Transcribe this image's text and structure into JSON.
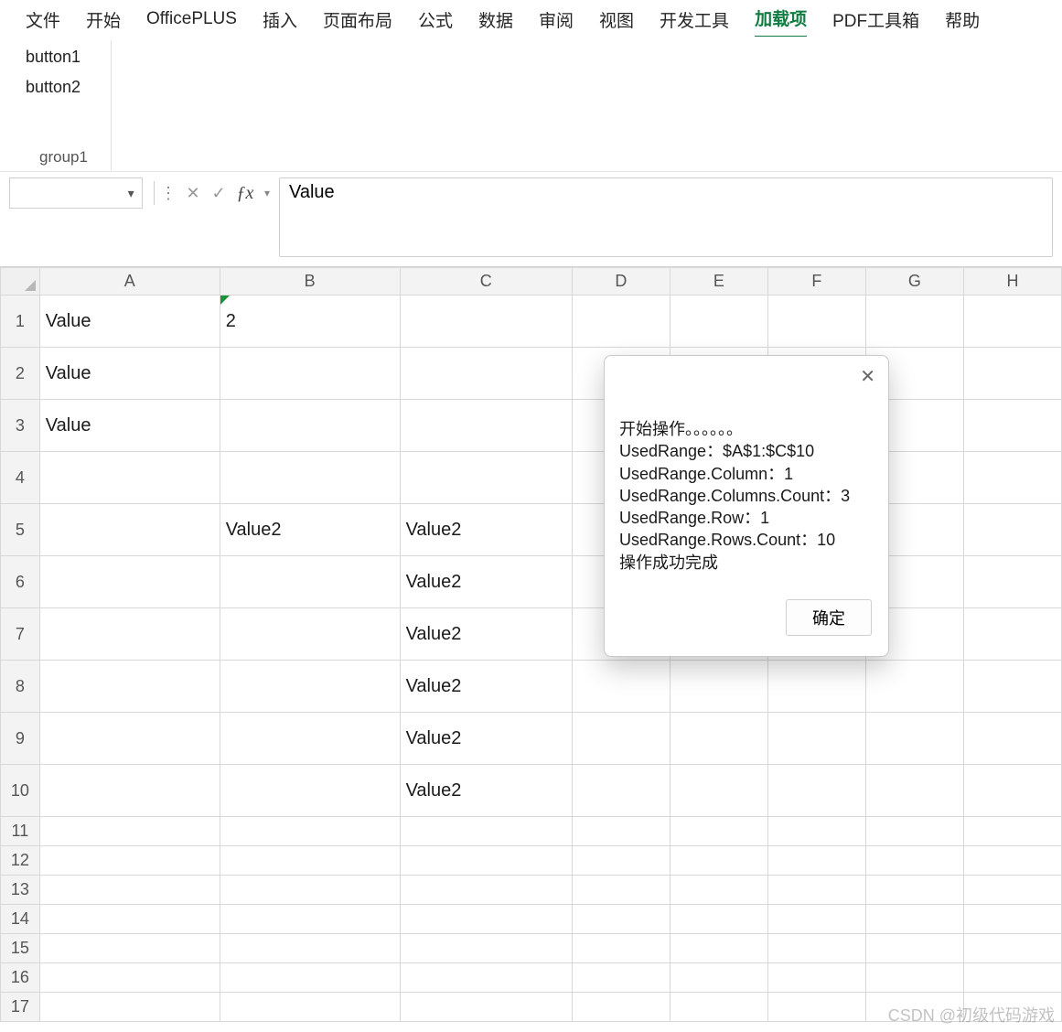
{
  "ribbon": {
    "tabs": [
      "文件",
      "开始",
      "OfficePLUS",
      "插入",
      "页面布局",
      "公式",
      "数据",
      "审阅",
      "视图",
      "开发工具",
      "加载项",
      "PDF工具箱",
      "帮助"
    ],
    "active_index": 10
  },
  "addin": {
    "buttons": [
      "button1",
      "button2"
    ],
    "group_label": "group1"
  },
  "namebox": {
    "value": ""
  },
  "formula_bar": {
    "value": "Value"
  },
  "grid": {
    "columns": [
      "A",
      "B",
      "C",
      "D",
      "E",
      "F",
      "G",
      "H"
    ],
    "row_count": 17,
    "tall_rows": 10,
    "cells": {
      "A1": "Value",
      "B1": "2",
      "A2": "Value",
      "A3": "Value",
      "B5": "Value2",
      "C5": "Value2",
      "C6": "Value2",
      "C7": "Value2",
      "C8": "Value2",
      "C9": "Value2",
      "C10": "Value2"
    }
  },
  "dialog": {
    "lines": [
      "开始操作。。。。。。",
      " UsedRange：$A$1:$C$10",
      " UsedRange.Column：1",
      " UsedRange.Columns.Count：3",
      " UsedRange.Row：1",
      " UsedRange.Rows.Count：10",
      "操作成功完成"
    ],
    "ok_label": "确定"
  },
  "watermark": "CSDN @初级代码游戏"
}
